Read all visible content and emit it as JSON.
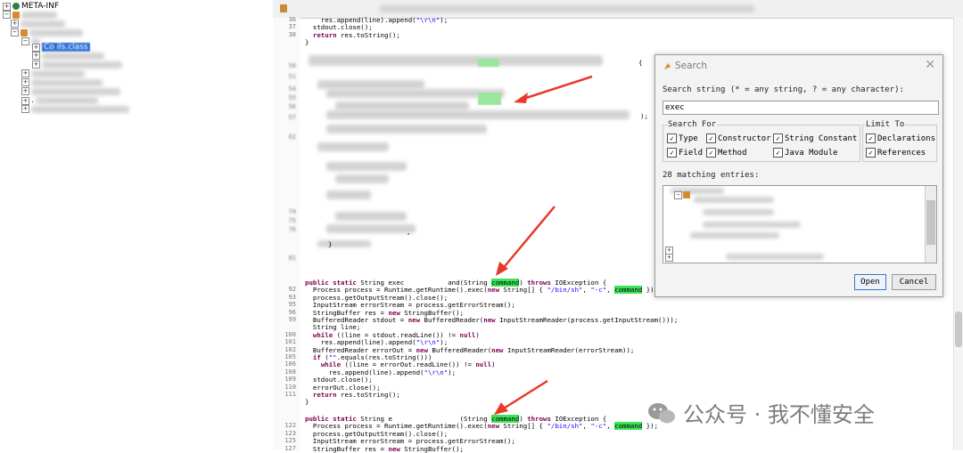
{
  "tree": {
    "root_label": "META-INF",
    "selected_label": "Co      ils.class",
    "dot_label": "."
  },
  "code": {
    "lines": [
      {
        "n": "36",
        "t": "    res.append(line).append(\"\\r\\n\");"
      },
      {
        "n": "37",
        "t": "  stdout.close();"
      },
      {
        "n": "38",
        "t": "  return res.toString();"
      },
      {
        "n": "",
        "t": "}"
      }
    ],
    "blk1": [
      {
        "n": "",
        "t": "public static String exec           and(String command) throws IOException {"
      },
      {
        "n": "92",
        "t": "  Process process = Runtime.getRuntime().exec(new String[] { \"/bin/sh\", \"-c\", command });"
      },
      {
        "n": "93",
        "t": "  process.getOutputStream().close();"
      },
      {
        "n": "95",
        "t": "  InputStream errorStream = process.getErrorStream();"
      },
      {
        "n": "96",
        "t": "  StringBuffer res = new StringBuffer();"
      },
      {
        "n": "99",
        "t": "  BufferedReader stdout = new BufferedReader(new InputStreamReader(process.getInputStream()));"
      },
      {
        "n": "",
        "t": "  String line;"
      },
      {
        "n": "100",
        "t": "  while ((line = stdout.readLine()) != null)"
      },
      {
        "n": "101",
        "t": "    res.append(line).append(\"\\r\\n\");"
      },
      {
        "n": "102",
        "t": "  BufferedReader errorOut = new BufferedReader(new InputStreamReader(errorStream));"
      },
      {
        "n": "105",
        "t": "  if (\"\".equals(res.toString()))"
      },
      {
        "n": "106",
        "t": "    while ((line = errorOut.readLine()) != null)"
      },
      {
        "n": "108",
        "t": "      res.append(line).append(\"\\r\\n\");"
      },
      {
        "n": "109",
        "t": "  stdout.close();"
      },
      {
        "n": "110",
        "t": "  errorOut.close();"
      },
      {
        "n": "111",
        "t": "  return res.toString();"
      },
      {
        "n": "",
        "t": "}"
      }
    ],
    "blk2": [
      {
        "n": "",
        "t": "public static String e                 (String command) throws IOException {"
      },
      {
        "n": "122",
        "t": "  Process process = Runtime.getRuntime().exec(new String[] { \"/bin/sh\", \"-c\", command });"
      },
      {
        "n": "123",
        "t": "  process.getOutputStream().close();"
      },
      {
        "n": "125",
        "t": "  InputStream errorStream = process.getErrorStream();"
      },
      {
        "n": "127",
        "t": "  StringBuffer res = new StringBuffer();"
      }
    ],
    "mid_numbers": [
      "50",
      "51",
      "54",
      "55",
      "56",
      "57",
      "62",
      "74",
      "75",
      "76",
      "81"
    ],
    "mid_braces": [
      "{",
      ");",
      "}",
      ","
    ]
  },
  "search": {
    "title": "Search",
    "prompt": "Search string (* = any string, ? = any character):",
    "query": "exec",
    "search_for_label": "Search For",
    "limit_to_label": "Limit To",
    "options": {
      "type": "Type",
      "constructor": "Constructor",
      "string_constant": "String Constant",
      "field": "Field",
      "method": "Method",
      "java_module": "Java Module",
      "declarations": "Declarations",
      "references": "References"
    },
    "matches": "28 matching entries:",
    "open_label": "Open",
    "cancel_label": "Cancel"
  },
  "watermark": {
    "text": "公众号 · 我不懂安全"
  },
  "colors": {
    "highlight": "#3ee35b",
    "arrow": "#e8392a",
    "keyword": "#7f0055",
    "string": "#2a00ff",
    "selection": "#2f6fd8"
  },
  "icons": [
    "plus-expander-icon",
    "minus-expander-icon",
    "package-icon",
    "globe-icon",
    "java-icon",
    "close-icon",
    "checkbox-checked-icon",
    "wechat-icon"
  ]
}
